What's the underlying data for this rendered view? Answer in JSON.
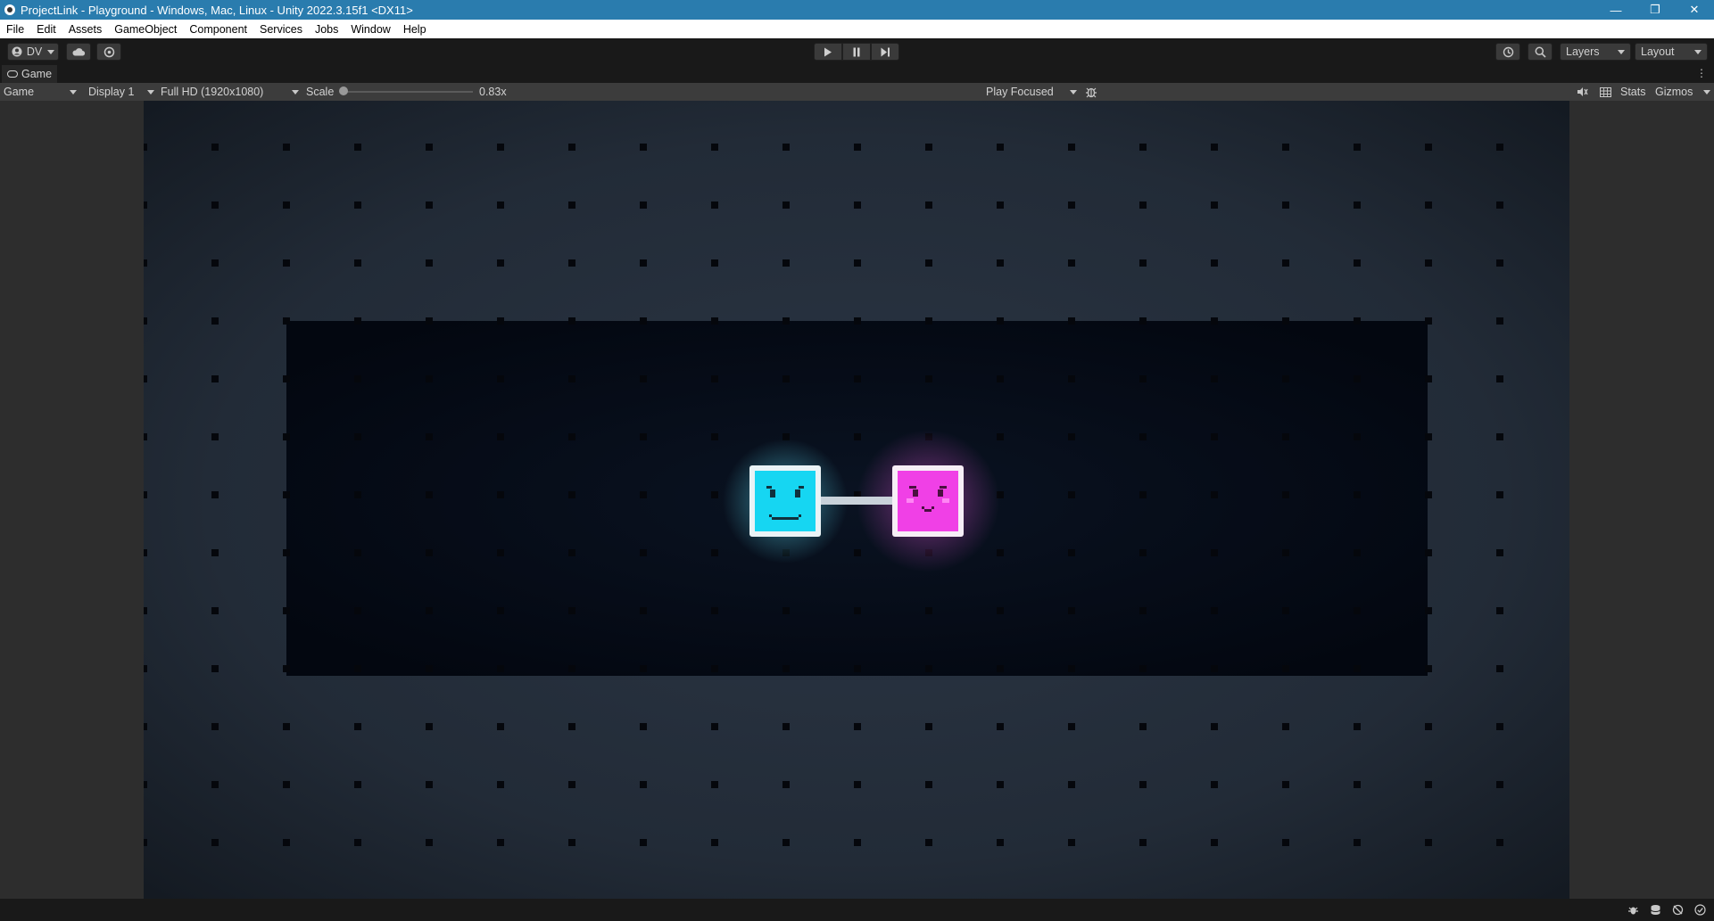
{
  "window": {
    "title": "ProjectLink - Playground - Windows, Mac, Linux - Unity 2022.3.15f1 <DX11>",
    "minimize_glyph": "—",
    "maximize_glyph": "❐",
    "close_glyph": "✕"
  },
  "menu": {
    "items": [
      "File",
      "Edit",
      "Assets",
      "GameObject",
      "Component",
      "Services",
      "Jobs",
      "Window",
      "Help"
    ]
  },
  "toolbar": {
    "account_label": "DV",
    "layers_label": "Layers",
    "layout_label": "Layout"
  },
  "tab": {
    "label": "Game"
  },
  "game_toolbar": {
    "view_mode": "Game",
    "display": "Display 1",
    "resolution": "Full HD (1920x1080)",
    "scale_label": "Scale",
    "scale_value": "0.83x",
    "play_mode": "Play Focused",
    "stats_label": "Stats",
    "gizmos_label": "Gizmos"
  },
  "colors": {
    "cyan_player": "#16d6f2",
    "magenta_player": "#f040e6",
    "grid_dot": "#05070c",
    "outer_bg": "#252f3c",
    "inner_bg": "#050b15"
  },
  "icons": {
    "account": "account-icon",
    "cloud": "cloud-icon",
    "collab": "collab-icon",
    "play": "play-icon",
    "pause": "pause-icon",
    "step": "step-icon",
    "history": "history-icon",
    "search": "search-icon",
    "bug": "bug-icon"
  }
}
